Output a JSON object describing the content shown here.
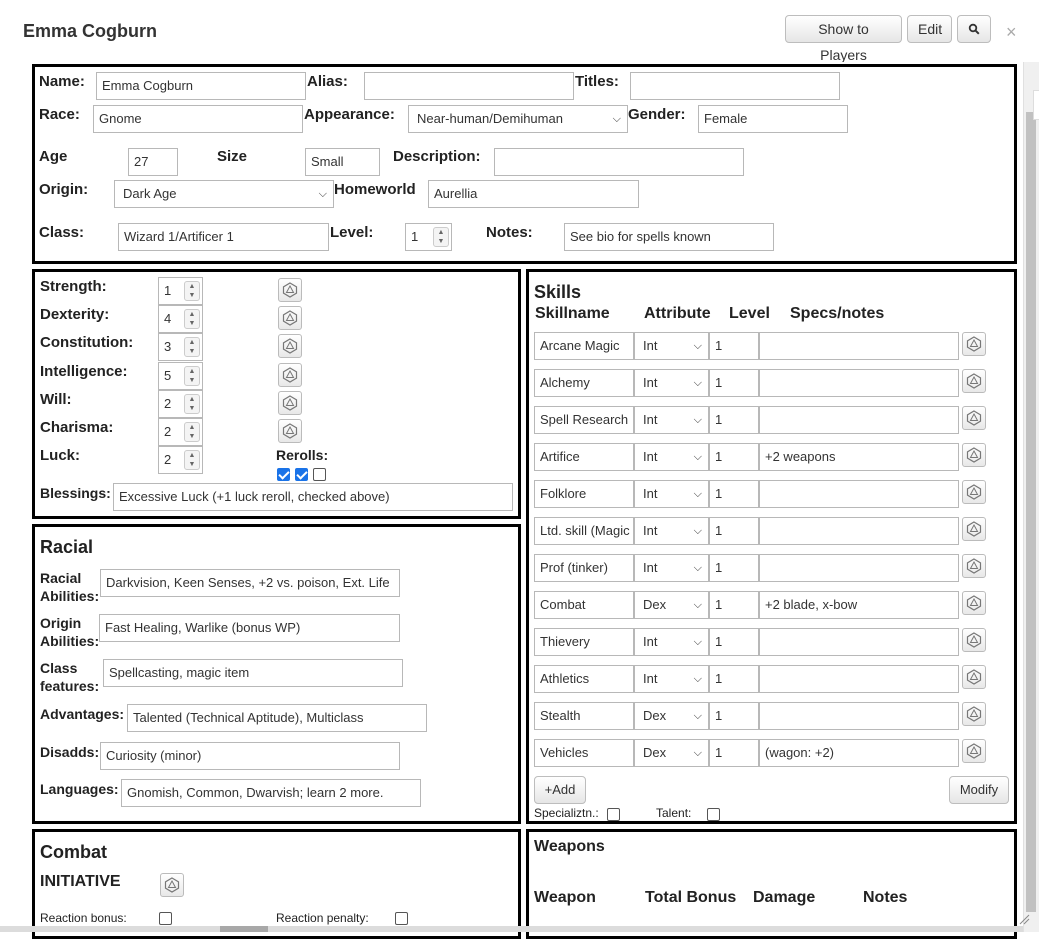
{
  "window": {
    "title": "Emma Cogburn",
    "buttons": {
      "show_to_players": "Show to Players",
      "edit": "Edit"
    },
    "close": "×"
  },
  "info": {
    "name_label": "Name:",
    "name_value": "Emma Cogburn",
    "alias_label": "Alias:",
    "alias_value": "",
    "titles_label": "Titles:",
    "titles_value": "",
    "race_label": "Race:",
    "race_value": "Gnome",
    "appearance_label": "Appearance:",
    "appearance_value": "Near-human/Demihuman",
    "gender_label": "Gender:",
    "gender_value": "Female",
    "age_label": "Age",
    "age_value": "27",
    "size_label": "Size",
    "size_value": "Small",
    "description_label": "Description:",
    "description_value": "",
    "origin_label": "Origin:",
    "origin_value": "Dark Age",
    "homeworld_label": "Homeworld",
    "homeworld_value": "Aurellia",
    "class_label": "Class:",
    "class_value": "Wizard 1/Artificer 1",
    "level_label": "Level:",
    "level_value": "1",
    "notes_label": "Notes:",
    "notes_value": "See bio for spells known"
  },
  "attributes": {
    "items": [
      {
        "label": "Strength:",
        "value": "1"
      },
      {
        "label": "Dexterity:",
        "value": "4"
      },
      {
        "label": "Constitution:",
        "value": "3"
      },
      {
        "label": "Intelligence:",
        "value": "5"
      },
      {
        "label": "Will:",
        "value": "2"
      },
      {
        "label": "Charisma:",
        "value": "2"
      },
      {
        "label": "Luck:",
        "value": "2"
      }
    ],
    "rerolls_label": "Rerolls:",
    "rerolls": [
      true,
      true,
      false
    ],
    "blessings_label": "Blessings:",
    "blessings_value": "Excessive Luck (+1 luck reroll, checked above)"
  },
  "racial": {
    "heading": "Racial",
    "racial_abilities_label_1": "Racial",
    "racial_abilities_label_2": "Abilities:",
    "racial_abilities_value": "Darkvision, Keen Senses, +2 vs. poison, Ext. Life",
    "origin_abilities_label_1": "Origin",
    "origin_abilities_label_2": "Abilities:",
    "origin_abilities_value": "Fast Healing, Warlike (bonus WP)",
    "class_features_label_1": "Class",
    "class_features_label_2": "features:",
    "class_features_value": "Spellcasting, magic item",
    "advantages_label": "Advantages:",
    "advantages_value": "Talented (Technical Aptitude), Multiclass",
    "disadds_label": "Disadds:",
    "disadds_value": "Curiosity (minor)",
    "languages_label": "Languages:",
    "languages_value": "Gnomish, Common, Dwarvish; learn 2 more."
  },
  "skills": {
    "heading": "Skills",
    "col_skillname": "Skillname",
    "col_attribute": "Attribute",
    "col_level": "Level",
    "col_specs": "Specs/notes",
    "rows": [
      {
        "name": "Arcane Magic",
        "attr": "Int",
        "level": "1",
        "notes": ""
      },
      {
        "name": "Alchemy",
        "attr": "Int",
        "level": "1",
        "notes": ""
      },
      {
        "name": "Spell Research",
        "attr": "Int",
        "level": "1",
        "notes": ""
      },
      {
        "name": "Artifice",
        "attr": "Int",
        "level": "1",
        "notes": "+2 weapons"
      },
      {
        "name": "Folklore",
        "attr": "Int",
        "level": "1",
        "notes": ""
      },
      {
        "name": "Ltd. skill (Magic",
        "attr": "Int",
        "level": "1",
        "notes": ""
      },
      {
        "name": "Prof (tinker)",
        "attr": "Int",
        "level": "1",
        "notes": ""
      },
      {
        "name": "Combat",
        "attr": "Dex",
        "level": "1",
        "notes": "+2 blade, x-bow"
      },
      {
        "name": "Thievery",
        "attr": "Int",
        "level": "1",
        "notes": ""
      },
      {
        "name": "Athletics",
        "attr": "Int",
        "level": "1",
        "notes": ""
      },
      {
        "name": "Stealth",
        "attr": "Dex",
        "level": "1",
        "notes": ""
      },
      {
        "name": "Vehicles",
        "attr": "Dex",
        "level": "1",
        "notes": "(wagon: +2)"
      }
    ],
    "add_button": "+Add",
    "modify_button": "Modify",
    "specialization_label": "Specializtn.:",
    "talent_label": "Talent:"
  },
  "combat": {
    "heading": "Combat",
    "initiative_label": "INITIATIVE",
    "reaction_bonus_label": "Reaction bonus:",
    "reaction_penalty_label": "Reaction penalty:"
  },
  "weapons": {
    "heading": "Weapons",
    "col_weapon": "Weapon",
    "col_total_bonus": "Total Bonus",
    "col_damage": "Damage",
    "col_notes": "Notes"
  }
}
